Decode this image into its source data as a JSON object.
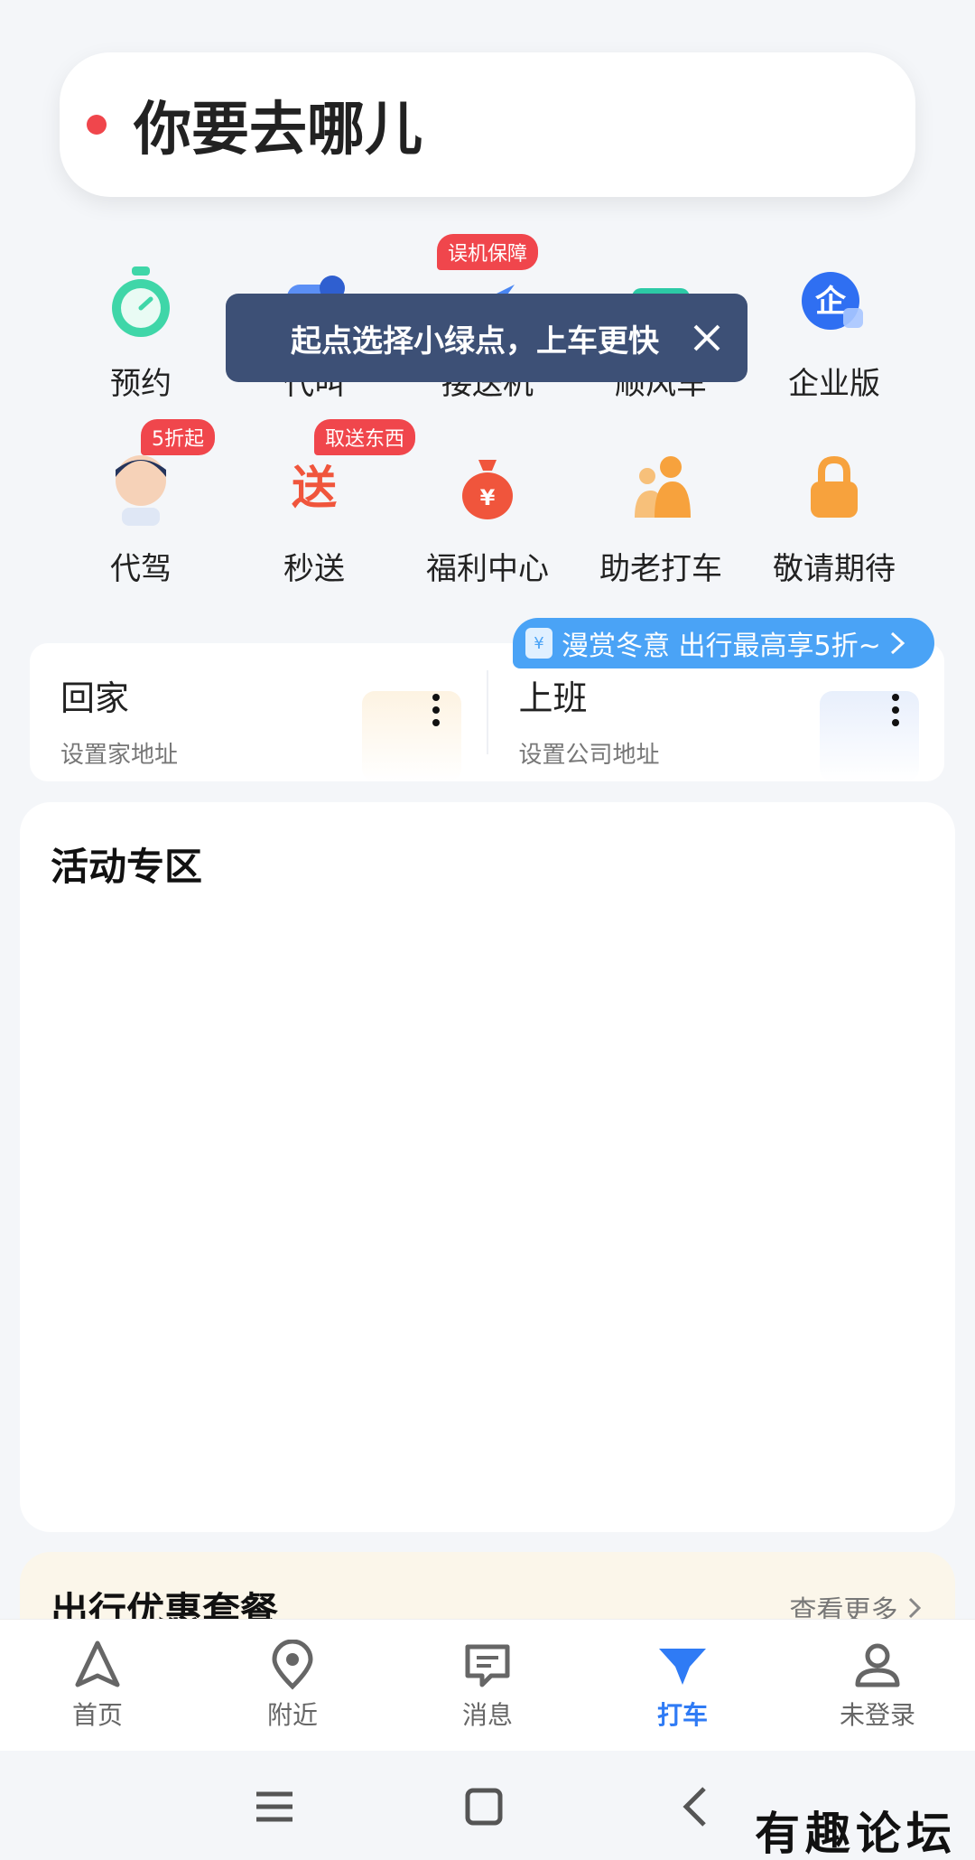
{
  "search": {
    "placeholder_text": "你要去哪儿"
  },
  "services_row1": [
    {
      "label": "预约",
      "icon": "stopwatch-icon"
    },
    {
      "label": "代叫",
      "icon": "call-car-icon"
    },
    {
      "label": "接送机",
      "icon": "airplane-icon",
      "badge": "误机保障"
    },
    {
      "label": "顺风车",
      "icon": "carpool-icon"
    },
    {
      "label": "企业版",
      "icon": "enterprise-icon"
    }
  ],
  "services_row2": [
    {
      "label": "代驾",
      "icon": "driver-avatar-icon",
      "badge": "5折起"
    },
    {
      "label": "秒送",
      "icon": "delivery-icon",
      "badge": "取送东西"
    },
    {
      "label": "福利中心",
      "icon": "money-bag-icon"
    },
    {
      "label": "助老打车",
      "icon": "elderly-care-icon"
    },
    {
      "label": "敬请期待",
      "icon": "lock-icon"
    }
  ],
  "tooltip": {
    "text": "起点选择小绿点，上车更快"
  },
  "promo": {
    "text": "漫赏冬意 出行最高享5折~",
    "coin_glyph": "¥"
  },
  "addresses": [
    {
      "title": "回家",
      "subtitle": "设置家地址"
    },
    {
      "title": "上班",
      "subtitle": "设置公司地址"
    }
  ],
  "activity": {
    "title": "活动专区"
  },
  "package": {
    "title": "出行优惠套餐",
    "more": "查看更多"
  },
  "tabs": [
    {
      "label": "首页",
      "icon": "navigation-arrow-icon",
      "active": false
    },
    {
      "label": "附近",
      "icon": "location-pin-icon",
      "active": false
    },
    {
      "label": "消息",
      "icon": "message-icon",
      "active": false
    },
    {
      "label": "打车",
      "icon": "taxi-icon",
      "active": true
    },
    {
      "label": "未登录",
      "icon": "user-icon",
      "active": false
    }
  ],
  "watermark": "有趣论坛",
  "colors": {
    "accent": "#2f7bf5",
    "badge": "#f0464c",
    "tooltip": "#3d5076",
    "promo": "#4aa3f6"
  }
}
